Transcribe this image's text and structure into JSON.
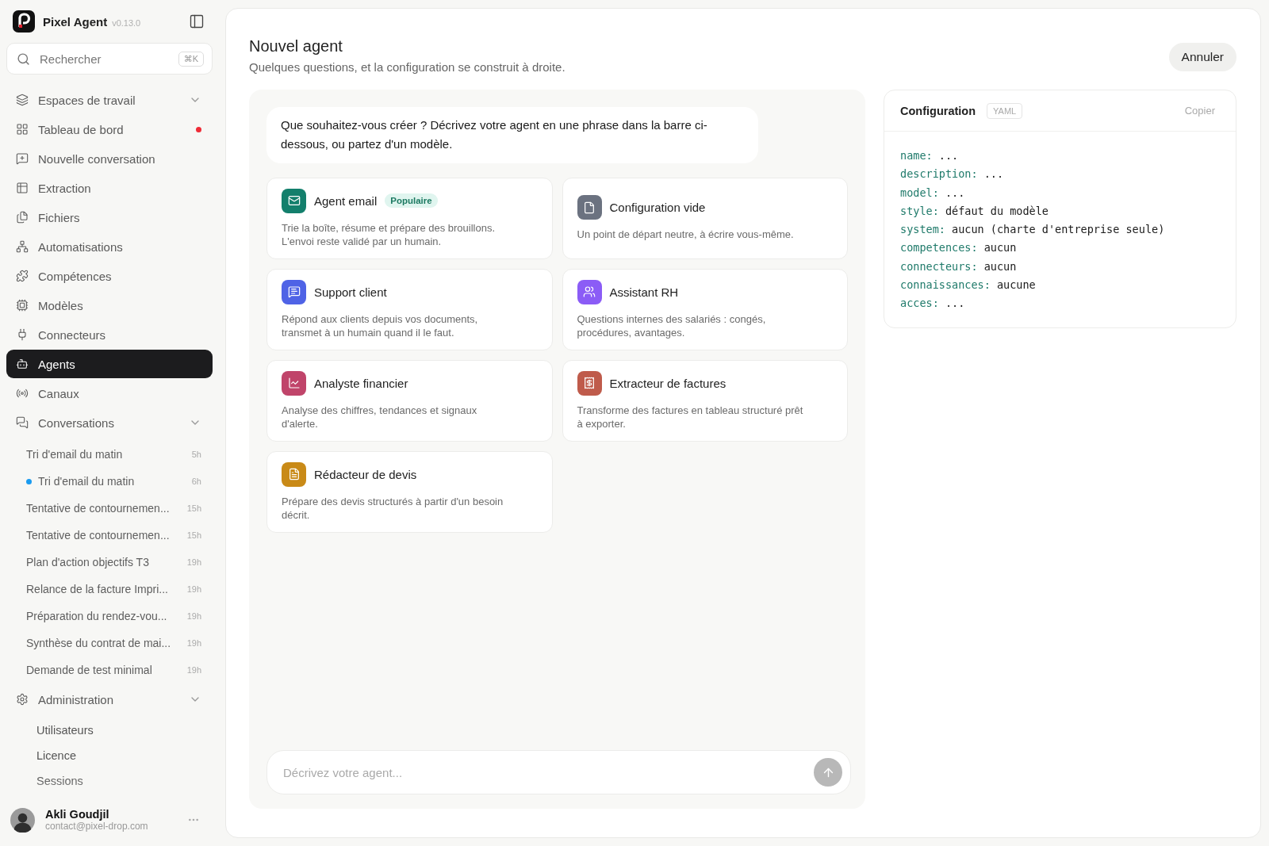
{
  "app": {
    "name": "Pixel Agent",
    "version": "v0.13.0"
  },
  "search": {
    "placeholder": "Rechercher",
    "shortcut": "⌘K"
  },
  "nav": [
    {
      "label": "Espaces de travail",
      "selected": false,
      "collapsible": true
    },
    {
      "label": "Tableau de bord",
      "selected": false,
      "alert": true
    },
    {
      "label": "Nouvelle conversation",
      "selected": false
    },
    {
      "label": "Extraction",
      "selected": false
    },
    {
      "label": "Fichiers",
      "selected": false
    },
    {
      "label": "Automatisations",
      "selected": false
    },
    {
      "label": "Compétences",
      "selected": false
    },
    {
      "label": "Modèles",
      "selected": false
    },
    {
      "label": "Connecteurs",
      "selected": false
    },
    {
      "label": "Agents",
      "selected": true
    },
    {
      "label": "Canaux",
      "selected": false
    },
    {
      "label": "Conversations",
      "selected": false,
      "collapsible": true,
      "children": [
        {
          "label": "Tri d'email du matin",
          "time": "5h",
          "unread": false
        },
        {
          "label": "Tri d'email du matin",
          "time": "6h",
          "unread": true
        },
        {
          "label": "Tentative de contournemen...",
          "time": "15h",
          "unread": false
        },
        {
          "label": "Tentative de contournemen...",
          "time": "15h",
          "unread": false
        },
        {
          "label": "Plan d'action objectifs T3",
          "time": "19h",
          "unread": false
        },
        {
          "label": "Relance de la facture Impri...",
          "time": "19h",
          "unread": false
        },
        {
          "label": "Préparation du rendez-vou...",
          "time": "19h",
          "unread": false
        },
        {
          "label": "Synthèse du contrat de mai...",
          "time": "19h",
          "unread": false
        },
        {
          "label": "Demande de test minimal",
          "time": "19h",
          "unread": false
        }
      ]
    },
    {
      "label": "Administration",
      "selected": false,
      "collapsible": true,
      "children": [
        {
          "label": "Utilisateurs"
        },
        {
          "label": "Licence"
        },
        {
          "label": "Sessions"
        }
      ]
    }
  ],
  "user": {
    "name": "Akli Goudjil",
    "email": "contact@pixel-drop.com"
  },
  "page": {
    "title": "Nouvel agent",
    "subtitle": "Quelques questions, et la configuration se construit à droite.",
    "cancel_button": "Annuler"
  },
  "assistant_message": "Que souhaitez-vous créer ? Décrivez votre agent en une phrase dans la barre ci-dessous, ou partez d'un modèle.",
  "templates": [
    {
      "title": "Agent email",
      "badge": "Populaire",
      "description": "Trie la boîte, résume et prépare des brouillons. L'envoi reste validé par un humain.",
      "color": "#137f6c"
    },
    {
      "title": "Configuration vide",
      "description": "Un point de départ neutre, à écrire vous-même.",
      "color": "#6b7280"
    },
    {
      "title": "Support client",
      "description": "Répond aux clients depuis vos documents, transmet à un humain quand il le faut.",
      "color": "#4f63e6"
    },
    {
      "title": "Assistant RH",
      "description": "Questions internes des salariés : congés, procédures, avantages.",
      "color": "#8b5cf6"
    },
    {
      "title": "Analyste financier",
      "description": "Analyse des chiffres, tendances et signaux d'alerte.",
      "color": "#c0446a"
    },
    {
      "title": "Extracteur de factures",
      "description": "Transforme des factures en tableau structuré prêt à exporter.",
      "color": "#bf5b4b"
    },
    {
      "title": "Rédacteur de devis",
      "description": "Prépare des devis structurés à partir d'un besoin décrit.",
      "color": "#c98a17"
    }
  ],
  "composer": {
    "placeholder": "Décrivez votre agent..."
  },
  "config": {
    "title": "Configuration",
    "format": "YAML",
    "copy_button": "Copier",
    "lines": [
      {
        "key": "name:",
        "value": "..."
      },
      {
        "key": "description:",
        "value": "..."
      },
      {
        "key": "model:",
        "value": "..."
      },
      {
        "key": "style:",
        "value": "défaut du modèle"
      },
      {
        "key": "system:",
        "value": "aucun (charte d'entreprise seule)"
      },
      {
        "key": "competences:",
        "value": "aucun"
      },
      {
        "key": "connecteurs:",
        "value": "aucun"
      },
      {
        "key": "connaissances:",
        "value": "aucune"
      },
      {
        "key": "acces:",
        "value": "..."
      }
    ]
  }
}
